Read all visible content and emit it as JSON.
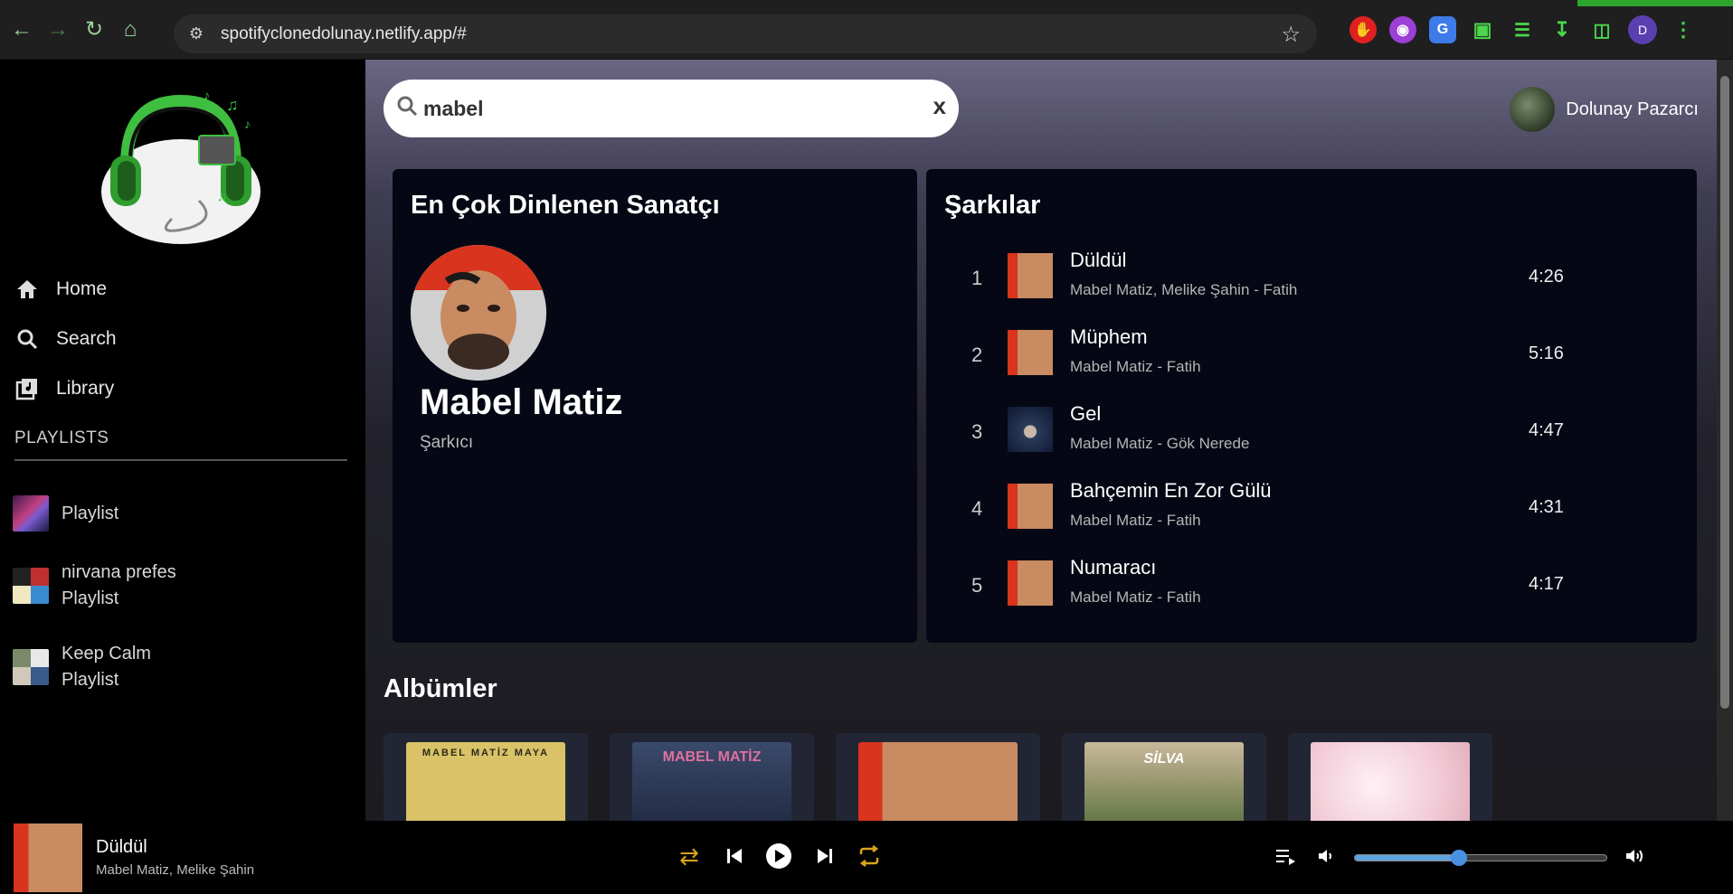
{
  "browser": {
    "url": "spotifyclonedolunay.netlify.app/#",
    "profile_initial": "D"
  },
  "sidebar": {
    "nav": [
      {
        "label": "Home",
        "icon": "home-icon"
      },
      {
        "label": "Search",
        "icon": "search-icon"
      },
      {
        "label": "Library",
        "icon": "library-icon"
      }
    ],
    "playlists_title": "PLAYLISTS",
    "playlists": [
      {
        "name": "Playlist",
        "sub": ""
      },
      {
        "name": "nirvana prefes",
        "sub": "Playlist"
      },
      {
        "name": "Keep Calm",
        "sub": "Playlist"
      }
    ]
  },
  "header": {
    "search_value": "mabel",
    "clear_label": "x",
    "user_name": "Dolunay Pazarcı"
  },
  "artist_section": {
    "title": "En Çok Dinlenen Sanatçı",
    "name": "Mabel Matiz",
    "role": "Şarkıcı"
  },
  "songs_section": {
    "title": "Şarkılar",
    "songs": [
      {
        "num": "1",
        "title": "Düldül",
        "artist": "Mabel Matiz, Melike Şahin - Fatih",
        "duration": "4:26"
      },
      {
        "num": "2",
        "title": "Müphem",
        "artist": "Mabel Matiz - Fatih",
        "duration": "5:16"
      },
      {
        "num": "3",
        "title": "Gel",
        "artist": "Mabel Matiz - Gök Nerede",
        "duration": "4:47"
      },
      {
        "num": "4",
        "title": "Bahçemin En Zor Gülü",
        "artist": "Mabel Matiz - Fatih",
        "duration": "4:31"
      },
      {
        "num": "5",
        "title": "Numaracı",
        "artist": "Mabel Matiz - Fatih",
        "duration": "4:17"
      }
    ]
  },
  "albums_section": {
    "title": "Albümler",
    "albums": [
      {
        "art_text": "MABEL MATİZ MAYA"
      },
      {
        "art_text": "MABEL MATİZ"
      },
      {
        "art_text": ""
      },
      {
        "art_text": "SİLVA"
      },
      {
        "art_text": ""
      }
    ]
  },
  "player": {
    "now_title": "Düldül",
    "now_artist": "Mabel Matiz, Melike Şahin",
    "volume": 0.41,
    "accent_color": "#d9a21b"
  }
}
